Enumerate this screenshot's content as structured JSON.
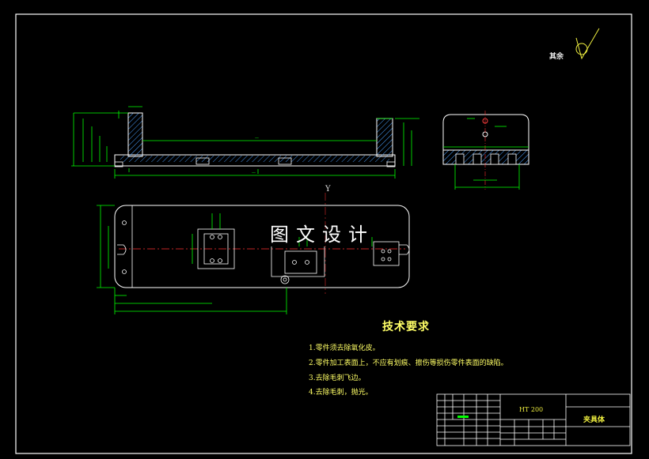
{
  "roughness_note": "其余",
  "watermark": "图文设计",
  "view_axis_label": "Y",
  "tech_requirements": {
    "title": "技术要求",
    "items": [
      "1.零件须去除氧化皮。",
      "2.零件加工表面上，不应有划痕、擦伤等损伤零件表面的缺陷。",
      "3.去除毛刺飞边。",
      "4.去除毛刺，抛光。"
    ]
  },
  "title_block": {
    "material": "HT 200",
    "part_name": "夹具体"
  },
  "colors": {
    "background": "#000000",
    "outline": "#ffffff",
    "dimension": "#00ff00",
    "centerline": "#ff3030",
    "notes": "#ffff66"
  }
}
